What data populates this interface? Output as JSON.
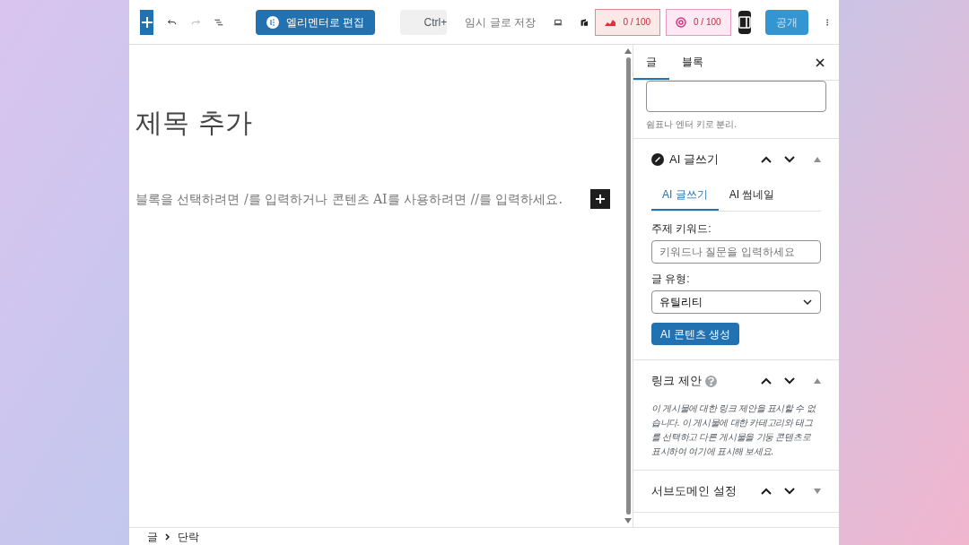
{
  "toolbar": {
    "history": [
      {
        "kind": "undo",
        "disabled": false
      },
      {
        "kind": "redo",
        "disabled": true
      }
    ],
    "elementor_button": "엘리멘터로 편집",
    "shortcut_hint": "Ctrl+",
    "save_draft": "임시 글로 저장",
    "scores": [
      {
        "kind": "seo",
        "text": "0 / 100"
      },
      {
        "kind": "readability",
        "text": "0 / 100"
      }
    ],
    "publish": {
      "label": "공개",
      "disabled": true
    }
  },
  "editor": {
    "title_placeholder": "제목 추가",
    "paragraph_placeholder": "블록을 선택하려면 /를 입력하거나 콘텐츠 AI를 사용하려면 //를 입력하세요."
  },
  "sidebar": {
    "tabs": [
      {
        "label": "글",
        "selected": true
      },
      {
        "label": "블록",
        "selected": false
      }
    ],
    "tags_hint": "쉼표나 엔터 키로 분리.",
    "panels": [
      {
        "kind": "ai",
        "title": "AI 글쓰기",
        "expanded": true,
        "subtabs": [
          {
            "label": "AI 글쓰기",
            "selected": true
          },
          {
            "label": "AI 썸네일",
            "selected": false
          }
        ],
        "keyword_label": "주제 키워드:",
        "keyword_placeholder": "키워드나 질문을 입력하세요",
        "type_label": "글 유형:",
        "type_value": "유틸리티",
        "generate_button": "AI 콘텐츠 생성"
      },
      {
        "kind": "links",
        "title": "링크 제안",
        "expanded": true,
        "text": "이 게시물에 대한 링크 제안을 표시할 수 없습니다. 이 게시물에 대한 카테고리와 태그를 선택하고 다른 게시물을 기둥 콘텐츠로 표시하여 여기에 표시해 보세요."
      },
      {
        "kind": "plain",
        "title": "서브도메인 설정",
        "expanded": false
      }
    ]
  },
  "breadcrumb": [
    "글",
    "단락"
  ]
}
